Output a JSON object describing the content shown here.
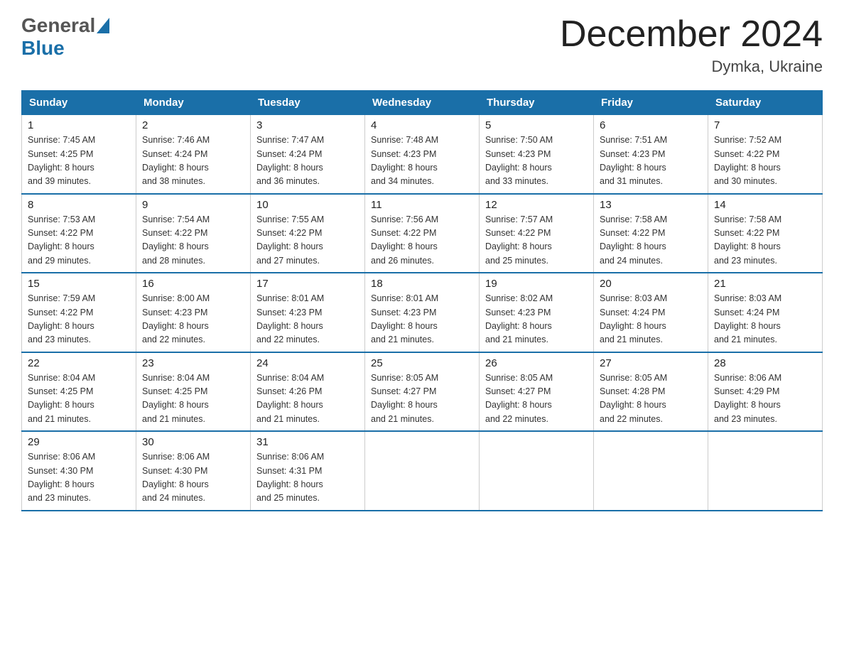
{
  "header": {
    "logo_general": "General",
    "logo_blue": "Blue",
    "title": "December 2024",
    "location": "Dymka, Ukraine"
  },
  "days_of_week": [
    "Sunday",
    "Monday",
    "Tuesday",
    "Wednesday",
    "Thursday",
    "Friday",
    "Saturday"
  ],
  "weeks": [
    [
      {
        "day": "1",
        "sunrise": "7:45 AM",
        "sunset": "4:25 PM",
        "daylight": "8 hours and 39 minutes."
      },
      {
        "day": "2",
        "sunrise": "7:46 AM",
        "sunset": "4:24 PM",
        "daylight": "8 hours and 38 minutes."
      },
      {
        "day": "3",
        "sunrise": "7:47 AM",
        "sunset": "4:24 PM",
        "daylight": "8 hours and 36 minutes."
      },
      {
        "day": "4",
        "sunrise": "7:48 AM",
        "sunset": "4:23 PM",
        "daylight": "8 hours and 34 minutes."
      },
      {
        "day": "5",
        "sunrise": "7:50 AM",
        "sunset": "4:23 PM",
        "daylight": "8 hours and 33 minutes."
      },
      {
        "day": "6",
        "sunrise": "7:51 AM",
        "sunset": "4:23 PM",
        "daylight": "8 hours and 31 minutes."
      },
      {
        "day": "7",
        "sunrise": "7:52 AM",
        "sunset": "4:22 PM",
        "daylight": "8 hours and 30 minutes."
      }
    ],
    [
      {
        "day": "8",
        "sunrise": "7:53 AM",
        "sunset": "4:22 PM",
        "daylight": "8 hours and 29 minutes."
      },
      {
        "day": "9",
        "sunrise": "7:54 AM",
        "sunset": "4:22 PM",
        "daylight": "8 hours and 28 minutes."
      },
      {
        "day": "10",
        "sunrise": "7:55 AM",
        "sunset": "4:22 PM",
        "daylight": "8 hours and 27 minutes."
      },
      {
        "day": "11",
        "sunrise": "7:56 AM",
        "sunset": "4:22 PM",
        "daylight": "8 hours and 26 minutes."
      },
      {
        "day": "12",
        "sunrise": "7:57 AM",
        "sunset": "4:22 PM",
        "daylight": "8 hours and 25 minutes."
      },
      {
        "day": "13",
        "sunrise": "7:58 AM",
        "sunset": "4:22 PM",
        "daylight": "8 hours and 24 minutes."
      },
      {
        "day": "14",
        "sunrise": "7:58 AM",
        "sunset": "4:22 PM",
        "daylight": "8 hours and 23 minutes."
      }
    ],
    [
      {
        "day": "15",
        "sunrise": "7:59 AM",
        "sunset": "4:22 PM",
        "daylight": "8 hours and 23 minutes."
      },
      {
        "day": "16",
        "sunrise": "8:00 AM",
        "sunset": "4:23 PM",
        "daylight": "8 hours and 22 minutes."
      },
      {
        "day": "17",
        "sunrise": "8:01 AM",
        "sunset": "4:23 PM",
        "daylight": "8 hours and 22 minutes."
      },
      {
        "day": "18",
        "sunrise": "8:01 AM",
        "sunset": "4:23 PM",
        "daylight": "8 hours and 21 minutes."
      },
      {
        "day": "19",
        "sunrise": "8:02 AM",
        "sunset": "4:23 PM",
        "daylight": "8 hours and 21 minutes."
      },
      {
        "day": "20",
        "sunrise": "8:03 AM",
        "sunset": "4:24 PM",
        "daylight": "8 hours and 21 minutes."
      },
      {
        "day": "21",
        "sunrise": "8:03 AM",
        "sunset": "4:24 PM",
        "daylight": "8 hours and 21 minutes."
      }
    ],
    [
      {
        "day": "22",
        "sunrise": "8:04 AM",
        "sunset": "4:25 PM",
        "daylight": "8 hours and 21 minutes."
      },
      {
        "day": "23",
        "sunrise": "8:04 AM",
        "sunset": "4:25 PM",
        "daylight": "8 hours and 21 minutes."
      },
      {
        "day": "24",
        "sunrise": "8:04 AM",
        "sunset": "4:26 PM",
        "daylight": "8 hours and 21 minutes."
      },
      {
        "day": "25",
        "sunrise": "8:05 AM",
        "sunset": "4:27 PM",
        "daylight": "8 hours and 21 minutes."
      },
      {
        "day": "26",
        "sunrise": "8:05 AM",
        "sunset": "4:27 PM",
        "daylight": "8 hours and 22 minutes."
      },
      {
        "day": "27",
        "sunrise": "8:05 AM",
        "sunset": "4:28 PM",
        "daylight": "8 hours and 22 minutes."
      },
      {
        "day": "28",
        "sunrise": "8:06 AM",
        "sunset": "4:29 PM",
        "daylight": "8 hours and 23 minutes."
      }
    ],
    [
      {
        "day": "29",
        "sunrise": "8:06 AM",
        "sunset": "4:30 PM",
        "daylight": "8 hours and 23 minutes."
      },
      {
        "day": "30",
        "sunrise": "8:06 AM",
        "sunset": "4:30 PM",
        "daylight": "8 hours and 24 minutes."
      },
      {
        "day": "31",
        "sunrise": "8:06 AM",
        "sunset": "4:31 PM",
        "daylight": "8 hours and 25 minutes."
      },
      null,
      null,
      null,
      null
    ]
  ],
  "labels": {
    "sunrise": "Sunrise: ",
    "sunset": "Sunset: ",
    "daylight": "Daylight: "
  }
}
